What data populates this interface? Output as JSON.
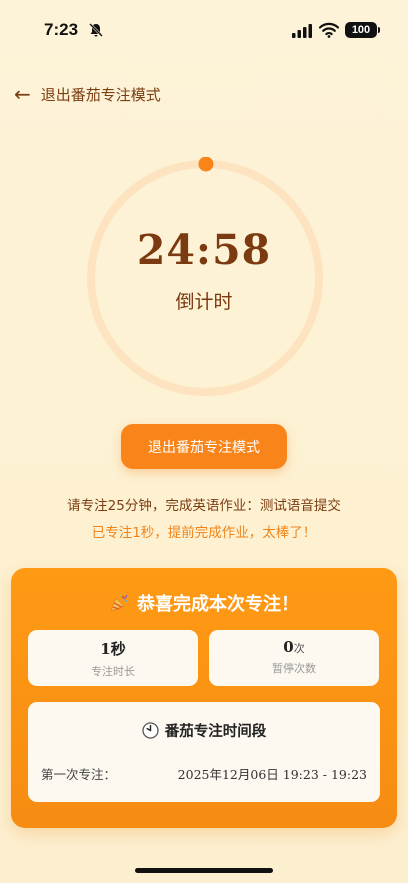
{
  "status_bar": {
    "time": "7:23",
    "battery": "100"
  },
  "nav": {
    "back_arrow": "←",
    "back_label": "退出番茄专注模式"
  },
  "timer": {
    "remaining": "24:58",
    "label": "倒计时",
    "progress_fraction": 0.0013
  },
  "actions": {
    "exit_button": "退出番茄专注模式"
  },
  "task": {
    "instruction": "请专注25分钟，完成英语作业：测试语音提交",
    "achievement": "已专注1秒，提前完成作业，太棒了！"
  },
  "completion": {
    "title": "恭喜完成本次专注！",
    "stats": [
      {
        "value": "1秒",
        "unit": "",
        "caption": "专注时长"
      },
      {
        "value": "0",
        "unit": "次",
        "caption": "暂停次数"
      }
    ],
    "period_title": "番茄专注时间段",
    "periods": [
      {
        "label": "第一次专注：",
        "value": "2025年12月06日 19:23 - 19:23"
      }
    ]
  },
  "colors": {
    "accent": "#f9851a",
    "ring": "#fde3bf",
    "text_brown": "#7b3a10",
    "background": "#fdf3d8"
  },
  "icons": {
    "back": "arrow-left-icon",
    "party": "party-popper-icon",
    "clock": "clock-icon",
    "mute": "bell-off-icon"
  }
}
